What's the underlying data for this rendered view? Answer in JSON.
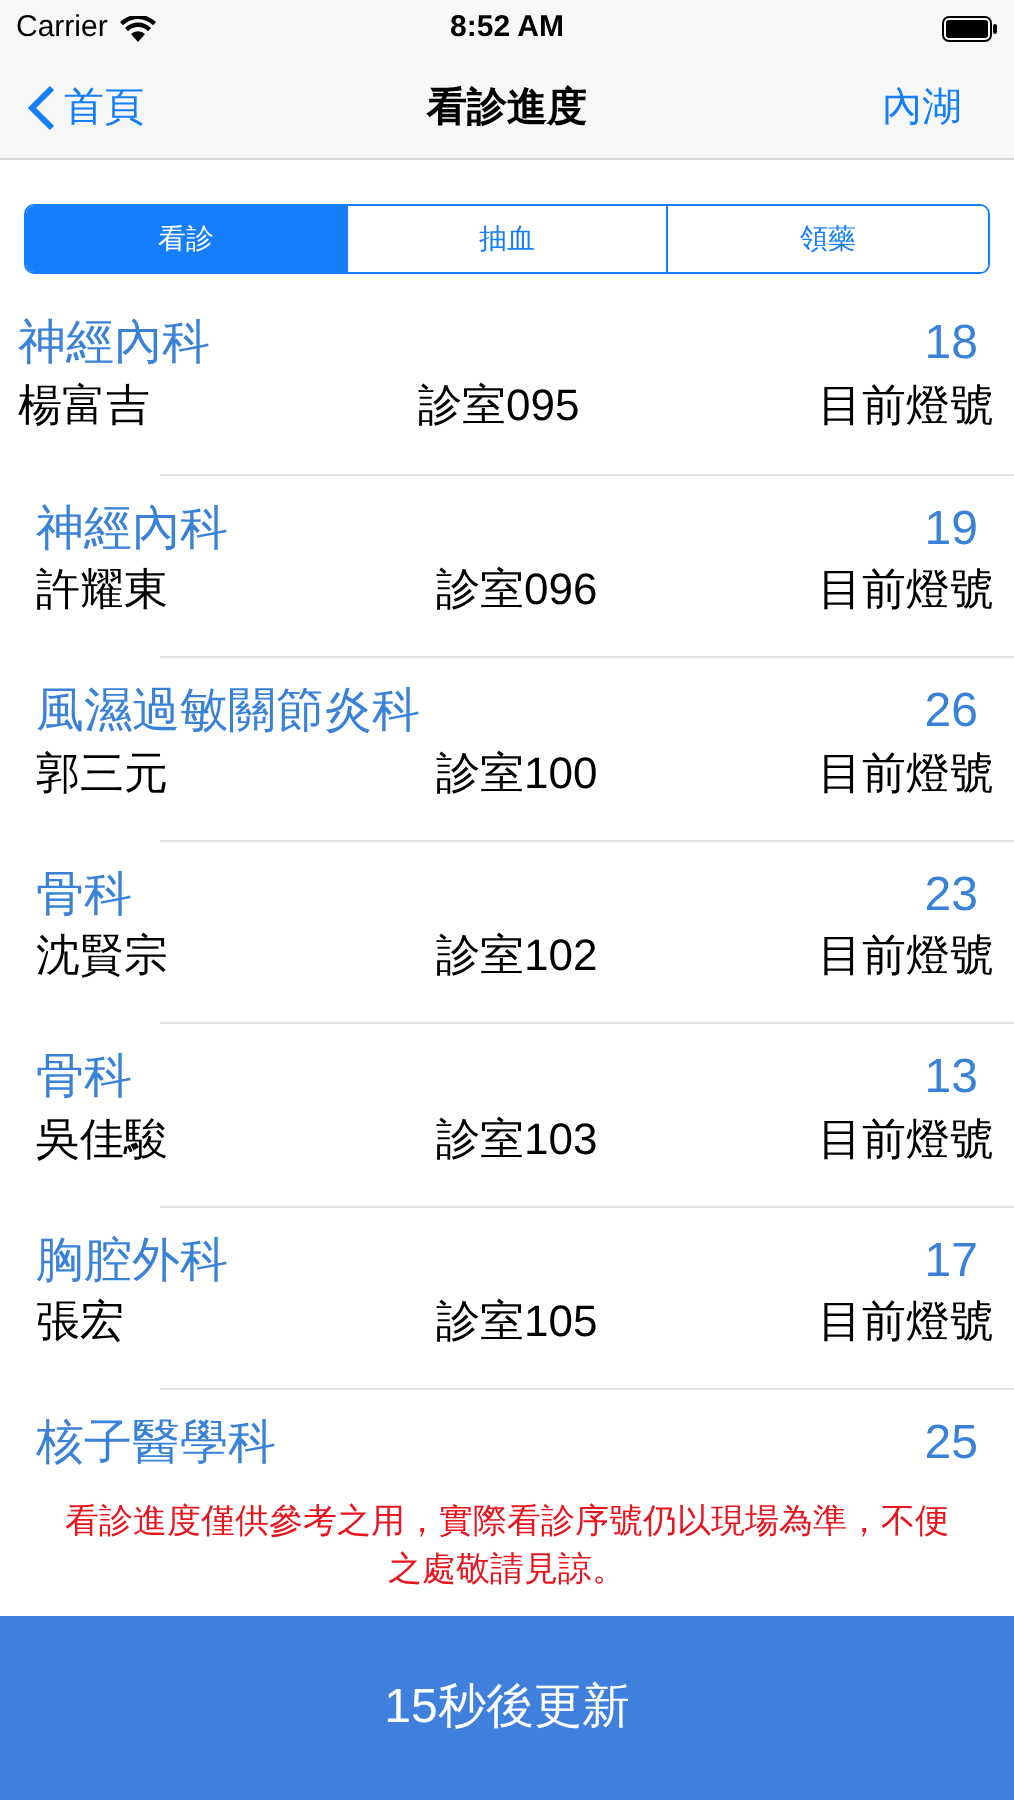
{
  "status_bar": {
    "carrier": "Carrier",
    "time": "8:52 AM"
  },
  "nav": {
    "back": "首頁",
    "title": "看診進度",
    "right": "內湖"
  },
  "tabs": [
    {
      "label": "看診",
      "selected": true
    },
    {
      "label": "抽血",
      "selected": false
    },
    {
      "label": "領藥",
      "selected": false
    }
  ],
  "rows": [
    {
      "department": "神經內科",
      "number": "18",
      "doctor": "楊富吉",
      "room": "診室095",
      "label": "目前燈號"
    },
    {
      "department": "神經內科",
      "number": "19",
      "doctor": "許耀東",
      "room": "診室096",
      "label": "目前燈號"
    },
    {
      "department": "風濕過敏關節炎科",
      "number": "26",
      "doctor": "郭三元",
      "room": "診室100",
      "label": "目前燈號"
    },
    {
      "department": "骨科",
      "number": "23",
      "doctor": "沈賢宗",
      "room": "診室102",
      "label": "目前燈號"
    },
    {
      "department": "骨科",
      "number": "13",
      "doctor": "吳佳駿",
      "room": "診室103",
      "label": "目前燈號"
    },
    {
      "department": "胸腔外科",
      "number": "17",
      "doctor": "張宏",
      "room": "診室105",
      "label": "目前燈號"
    },
    {
      "department": "核子醫學科",
      "number": "25"
    }
  ],
  "notice": "看診進度僅供參考之用，實際看診序號仍以現場為準，不便之處敬請見諒。",
  "refresh_button": "15秒後更新"
}
